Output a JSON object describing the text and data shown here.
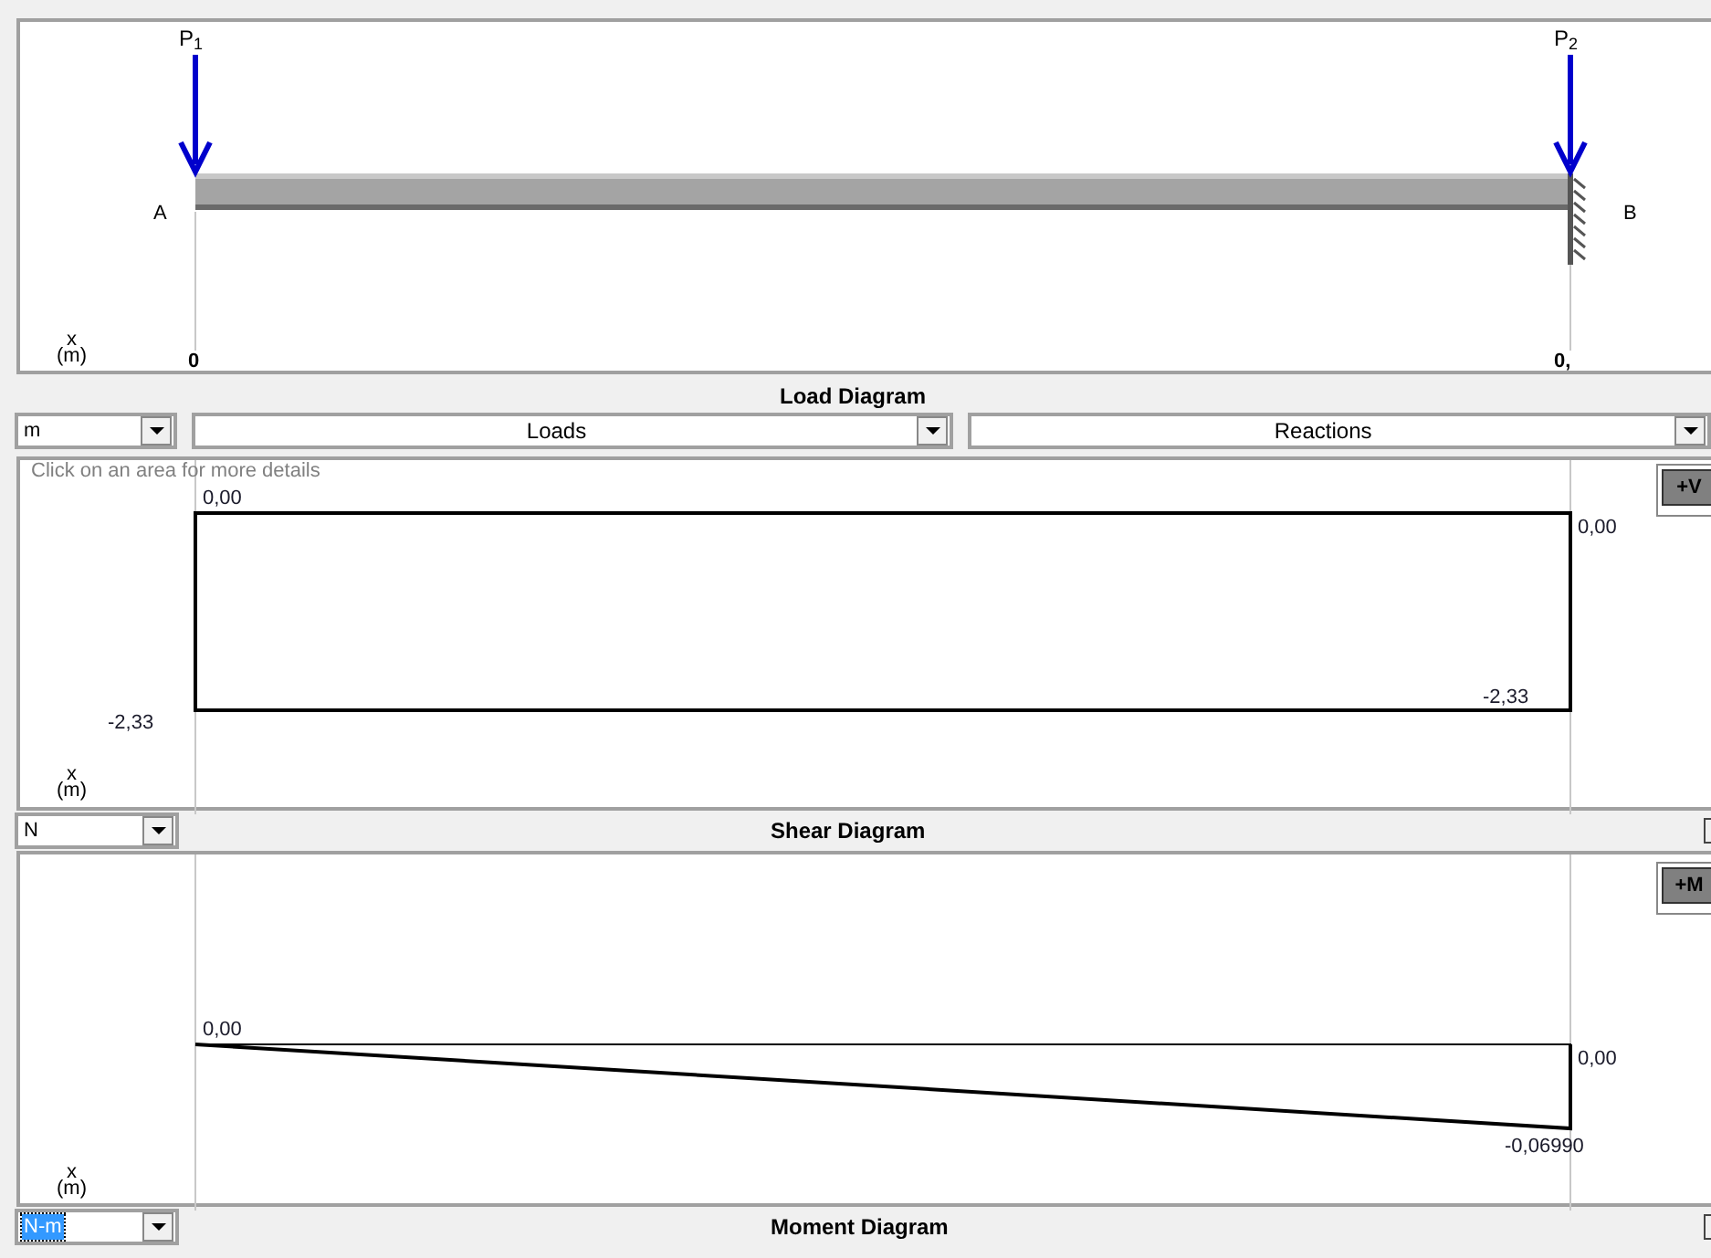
{
  "beam_panel": {
    "loads": [
      {
        "label": "P$_{1}$"
      },
      {
        "label": "P$_{2}$"
      }
    ],
    "support_left": "A",
    "support_right": "B",
    "x_label": "x",
    "unit": "(m)",
    "tick_start": "0",
    "tick_end": "0,"
  },
  "load_bar": {
    "title": "Load Diagram",
    "unit_select": {
      "value": "m",
      "focused": false
    },
    "loads_select": {
      "value": "Loads"
    },
    "reactions_select": {
      "value": "Reactions"
    }
  },
  "shear_panel": {
    "hint": "Click on an area for more details",
    "start_value": "0,00",
    "end_value": "0,00",
    "left_min": "-2,33",
    "right_min": "-2,33",
    "x_label": "x",
    "unit": "(m)",
    "button": "+V"
  },
  "shear_bar": {
    "title": "Shear Diagram",
    "unit_select": {
      "value": "N",
      "focused": false
    }
  },
  "moment_panel": {
    "start_value": "0,00",
    "end_value": "0,00",
    "end_min": "-0,06990",
    "x_label": "x",
    "unit": "(m)",
    "button": "+M"
  },
  "moment_bar": {
    "title": "Moment Diagram",
    "unit_select": {
      "value": "N-m",
      "focused": true
    }
  }
}
